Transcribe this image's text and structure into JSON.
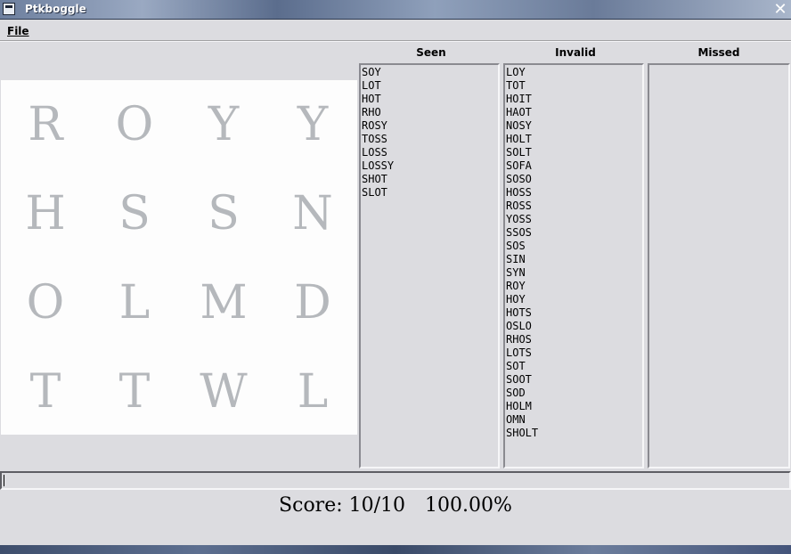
{
  "window": {
    "title": "Ptkboggle"
  },
  "menu": {
    "file": "File"
  },
  "columns": {
    "seen": "Seen",
    "invalid": "Invalid",
    "missed": "Missed"
  },
  "board": [
    [
      "R",
      "O",
      "Y",
      "Y"
    ],
    [
      "H",
      "S",
      "S",
      "N"
    ],
    [
      "O",
      "L",
      "M",
      "D"
    ],
    [
      "T",
      "T",
      "W",
      "L"
    ]
  ],
  "lists": {
    "seen": [
      "SOY",
      "LOT",
      "HOT",
      "RHO",
      "ROSY",
      "TOSS",
      "LOSS",
      "LOSSY",
      "SHOT",
      "SLOT"
    ],
    "invalid": [
      "LOY",
      "TOT",
      "HOIT",
      "HAOT",
      "NOSY",
      "HOLT",
      "SOLT",
      "SOFA",
      "SOSO",
      "HOSS",
      "ROSS",
      "YOSS",
      "SSOS",
      "SOS",
      "SIN",
      "SYN",
      "ROY",
      "HOY",
      "HOTS",
      "OSLO",
      "RHOS",
      "LOTS",
      "SOT",
      "SOOT",
      "SOD",
      "HOLM",
      "OMN",
      "SHOLT"
    ],
    "missed": []
  },
  "entry": {
    "value": ""
  },
  "score": {
    "label": "Score:",
    "value": "10/10",
    "percent": "100.00%"
  },
  "colors": {
    "letter": "#b5b8bc",
    "board_bg": "#fdfdfd",
    "window_bg": "#dcdce0"
  }
}
